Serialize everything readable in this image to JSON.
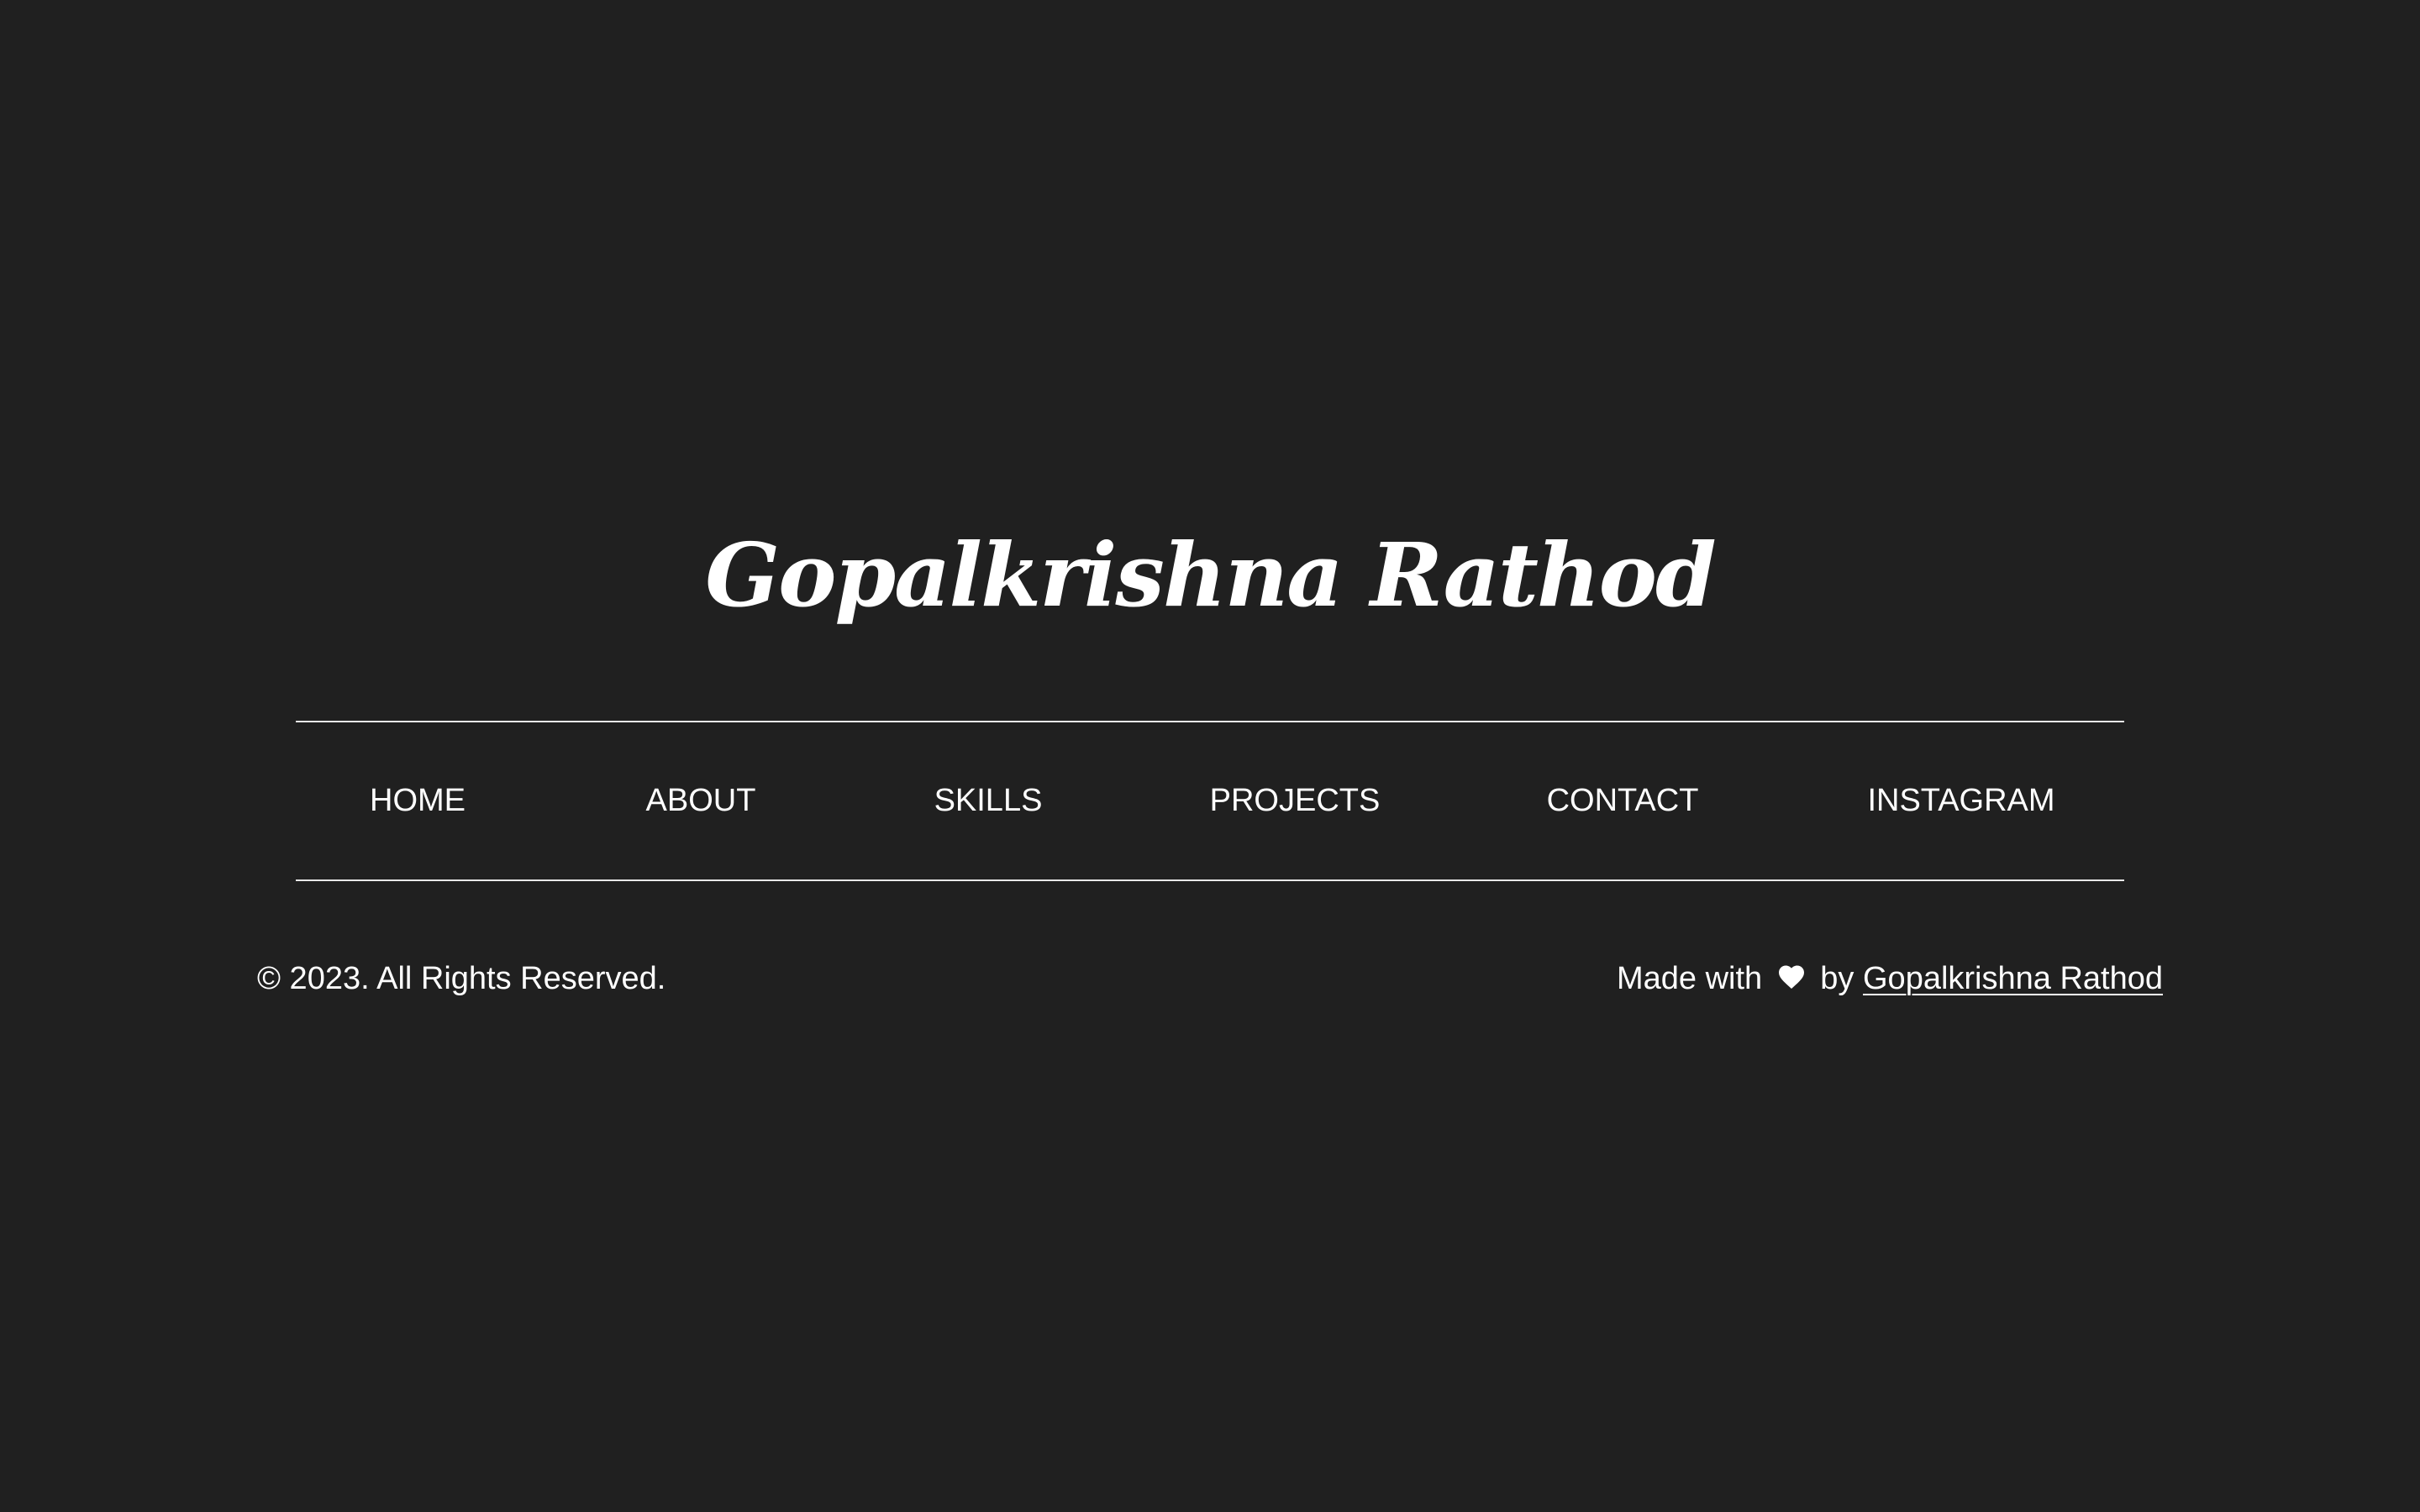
{
  "brand": {
    "name": "Gopalkrishna Rathod"
  },
  "nav": {
    "items": [
      {
        "label": "HOME"
      },
      {
        "label": "ABOUT"
      },
      {
        "label": "SKILLS"
      },
      {
        "label": "PROJECTS"
      },
      {
        "label": "CONTACT"
      },
      {
        "label": "INSTAGRAM"
      }
    ]
  },
  "footer": {
    "copyright": "© 2023. All Rights Reserved.",
    "made_with": "Made with",
    "heart_icon": "heart-icon",
    "by": "by",
    "author_link": "Gopalkrishna Rathod"
  },
  "colors": {
    "background": "#202020",
    "text": "#ffffff",
    "rule": "#e8e8e8"
  }
}
